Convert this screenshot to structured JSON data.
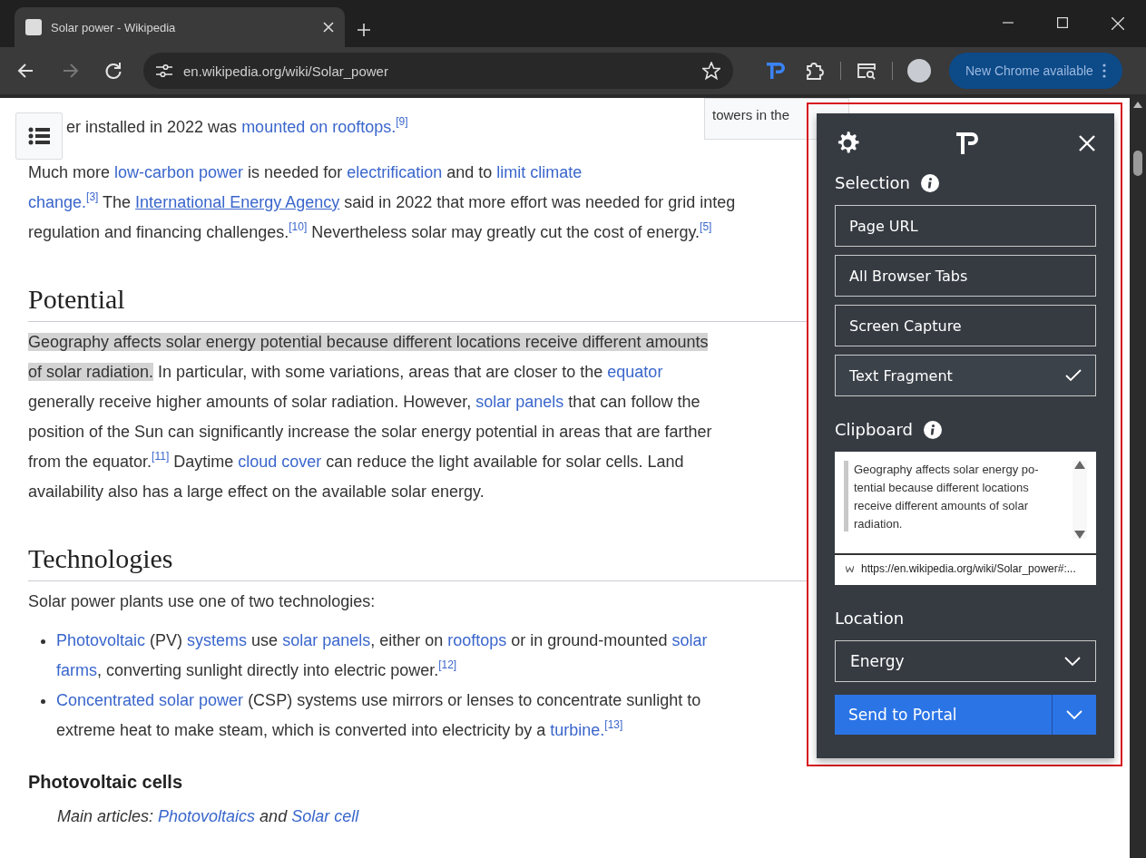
{
  "browser": {
    "tab": {
      "title": "Solar power - Wikipedia",
      "selected": true
    },
    "address": "en.wikipedia.org/wiki/Solar_power",
    "update_button": "New Chrome available"
  },
  "article": {
    "caption": "towers in the",
    "blocks": [
      {
        "kind": "toc-line",
        "segments": [
          {
            "kind": "text",
            "text": "er installed in 2022 was "
          },
          {
            "kind": "link",
            "text": "mounted on rooftops."
          },
          {
            "kind": "ref",
            "text": "[9]"
          }
        ]
      },
      {
        "kind": "paragraph",
        "segments": [
          {
            "kind": "text",
            "text": "Much more "
          },
          {
            "kind": "link",
            "text": "low-carbon power"
          },
          {
            "kind": "text",
            "text": " is needed for "
          },
          {
            "kind": "link",
            "text": "electrification"
          },
          {
            "kind": "text",
            "text": " and to "
          },
          {
            "kind": "link",
            "text": "limit climate"
          },
          {
            "kind": "break"
          },
          {
            "kind": "link",
            "text": "change."
          },
          {
            "kind": "ref",
            "text": "[3]"
          },
          {
            "kind": "text",
            "text": " The "
          },
          {
            "kind": "underlined-link",
            "text": "International Energy Agency"
          },
          {
            "kind": "text",
            "text": " said in 2022 that more effort was needed for grid integ"
          },
          {
            "kind": "break"
          },
          {
            "kind": "text",
            "text": "regulation and financing challenges."
          },
          {
            "kind": "ref",
            "text": "[10]"
          },
          {
            "kind": "text",
            "text": " Nevertheless solar may greatly cut the cost of energy."
          },
          {
            "kind": "ref",
            "text": "[5]"
          }
        ]
      },
      {
        "kind": "heading",
        "text": "Potential"
      },
      {
        "kind": "paragraph",
        "segments": [
          {
            "kind": "highlight",
            "text": "Geography affects solar energy potential because different locations receive different amounts"
          },
          {
            "kind": "break"
          },
          {
            "kind": "highlight",
            "text": "of solar radiation."
          },
          {
            "kind": "text",
            "text": " In particular, with some variations, areas that are closer to the "
          },
          {
            "kind": "link",
            "text": "equator"
          },
          {
            "kind": "break"
          },
          {
            "kind": "text",
            "text": "generally receive higher amounts of solar radiation. However, "
          },
          {
            "kind": "link",
            "text": "solar panels"
          },
          {
            "kind": "text",
            "text": " that can follow the"
          },
          {
            "kind": "break"
          },
          {
            "kind": "text",
            "text": "position of the Sun can significantly increase the solar energy potential in areas that are farther"
          },
          {
            "kind": "break"
          },
          {
            "kind": "text",
            "text": "from the equator."
          },
          {
            "kind": "ref",
            "text": "[11]"
          },
          {
            "kind": "text",
            "text": " Daytime "
          },
          {
            "kind": "link",
            "text": "cloud cover"
          },
          {
            "kind": "text",
            "text": " can reduce the light available for solar cells. Land"
          },
          {
            "kind": "break"
          },
          {
            "kind": "text",
            "text": "availability also has a large effect on the available solar energy."
          }
        ]
      },
      {
        "kind": "heading",
        "text": "Technologies"
      },
      {
        "kind": "paragraph",
        "segments": [
          {
            "kind": "text",
            "text": "Solar power plants use one of two technologies:"
          }
        ]
      },
      {
        "kind": "list",
        "items": [
          [
            {
              "kind": "link",
              "text": "Photovoltaic"
            },
            {
              "kind": "text",
              "text": " (PV) "
            },
            {
              "kind": "link",
              "text": "systems"
            },
            {
              "kind": "text",
              "text": " use "
            },
            {
              "kind": "link",
              "text": "solar panels"
            },
            {
              "kind": "text",
              "text": ", either on "
            },
            {
              "kind": "link",
              "text": "rooftops"
            },
            {
              "kind": "text",
              "text": " or in ground-mounted "
            },
            {
              "kind": "link",
              "text": "solar"
            },
            {
              "kind": "break"
            },
            {
              "kind": "link",
              "text": "farms"
            },
            {
              "kind": "text",
              "text": ", converting sunlight directly into electric power."
            },
            {
              "kind": "ref",
              "text": "[12]"
            }
          ],
          [
            {
              "kind": "link",
              "text": "Concentrated solar power"
            },
            {
              "kind": "text",
              "text": " (CSP) systems use mirrors or lenses to concentrate sunlight to"
            },
            {
              "kind": "break"
            },
            {
              "kind": "text",
              "text": "extreme heat to make steam, which is converted into electricity by a "
            },
            {
              "kind": "link",
              "text": "turbine."
            },
            {
              "kind": "ref",
              "text": "[13]"
            }
          ]
        ]
      },
      {
        "kind": "subheading",
        "text": "Photovoltaic cells"
      },
      {
        "kind": "hatnote",
        "segments": [
          {
            "kind": "text",
            "text": "Main articles: "
          },
          {
            "kind": "link",
            "text": "Photovoltaics"
          },
          {
            "kind": "text",
            "text": " and "
          },
          {
            "kind": "link",
            "text": "Solar cell"
          }
        ]
      }
    ]
  },
  "popup": {
    "sections": [
      {
        "kind": "options",
        "label": "Selection",
        "options": [
          {
            "label": "Page URL",
            "selected": false
          },
          {
            "label": "All Browser Tabs",
            "selected": false
          },
          {
            "label": "Screen Capture",
            "selected": false
          },
          {
            "label": "Text Fragment",
            "selected": true
          }
        ]
      },
      {
        "kind": "clipboard",
        "label": "Clipboard",
        "quote": "Geography affects solar energy po-tential because different locations receive different amounts of solar radiation.",
        "source": "https://en.wikipedia.org/wiki/Solar_power#:..."
      },
      {
        "kind": "location",
        "label": "Location",
        "value": "Energy"
      }
    ],
    "send_button": "Send to Portal"
  }
}
